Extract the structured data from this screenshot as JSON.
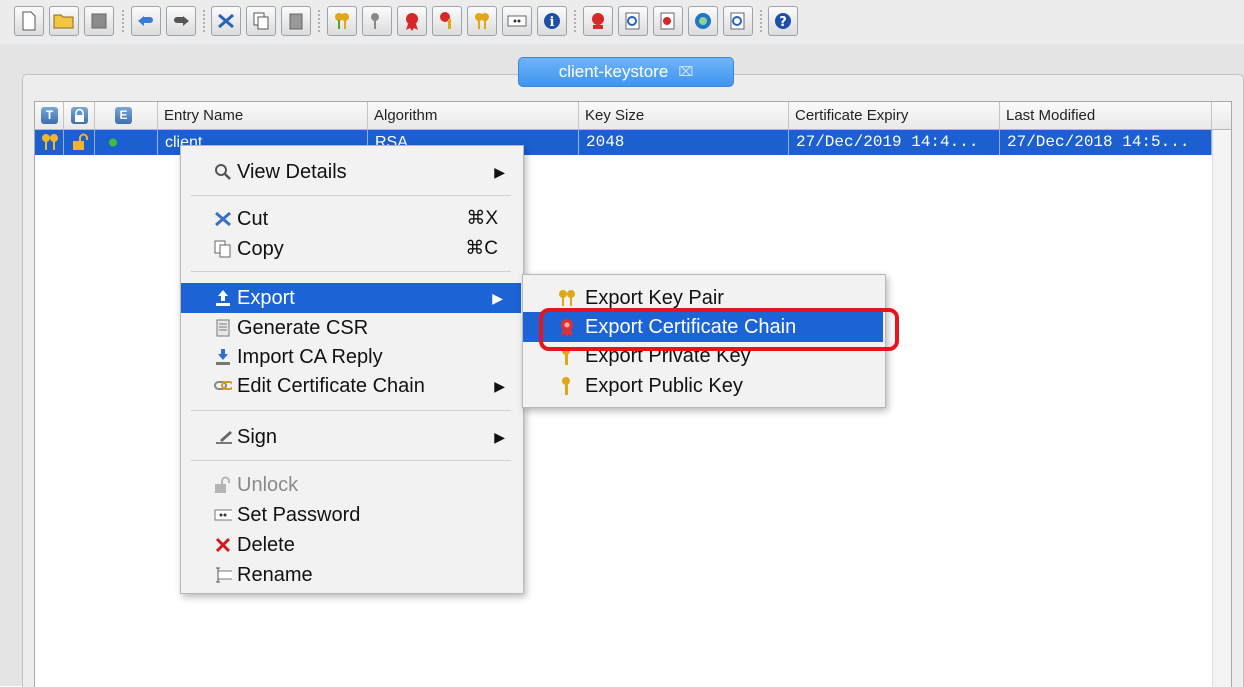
{
  "toolbar": {
    "buttons": [
      {
        "name": "new-keystore-icon"
      },
      {
        "name": "open-keystore-icon"
      },
      {
        "name": "save-keystore-icon"
      },
      {
        "name": "undo-icon"
      },
      {
        "name": "redo-icon"
      },
      {
        "name": "cut-icon"
      },
      {
        "name": "copy-icon"
      },
      {
        "name": "paste-icon"
      },
      {
        "name": "generate-key-pair-icon"
      },
      {
        "name": "generate-secret-key-icon"
      },
      {
        "name": "import-trusted-certificate-icon"
      },
      {
        "name": "import-key-pair-icon"
      },
      {
        "name": "set-password-icon"
      },
      {
        "name": "keystore-properties-icon"
      },
      {
        "name": "examine-file-icon"
      },
      {
        "name": "examine-clipboard-icon"
      },
      {
        "name": "examine-ssl-icon"
      },
      {
        "name": "examine-crl-icon"
      },
      {
        "name": "examine-csr-icon"
      },
      {
        "name": "help-icon"
      }
    ]
  },
  "tab": {
    "label": "client-keystore",
    "close": "⌧"
  },
  "table": {
    "icon_headers": [
      "T",
      "🔒",
      "E"
    ],
    "columns": [
      "Entry Name",
      "Algorithm",
      "Key Size",
      "Certificate Expiry",
      "Last Modified"
    ],
    "rows": [
      {
        "entry_name": "client",
        "algorithm": "RSA",
        "key_size": "2048",
        "certificate_expiry": "27/Dec/2019 14:4...",
        "last_modified": "27/Dec/2018 14:5..."
      }
    ]
  },
  "context_menu": {
    "view_details": "View Details",
    "cut": "Cut",
    "cut_shortcut": "⌘X",
    "copy": "Copy",
    "copy_shortcut": "⌘C",
    "export": "Export",
    "generate_csr": "Generate CSR",
    "import_ca_reply": "Import CA Reply",
    "edit_certificate_chain": "Edit Certificate Chain",
    "sign": "Sign",
    "unlock": "Unlock",
    "set_password": "Set Password",
    "delete": "Delete",
    "rename": "Rename"
  },
  "export_submenu": {
    "export_key_pair": "Export Key Pair",
    "export_certificate_chain": "Export Certificate Chain",
    "export_private_key": "Export Private Key",
    "export_public_key": "Export Public Key"
  },
  "colors": {
    "selection": "#1c63d6",
    "highlight_outline": "#e8141d",
    "tab_blue": "#3e95f0"
  }
}
